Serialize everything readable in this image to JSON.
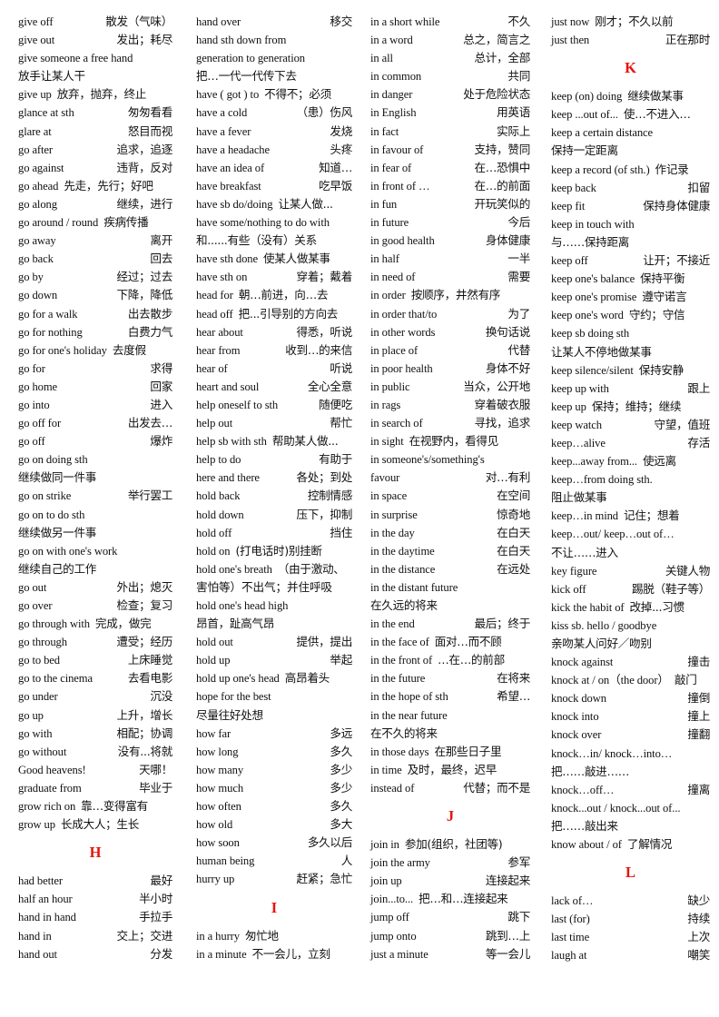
{
  "page": {
    "title": "English Phrase List G-L",
    "heading_color": "#e8140c",
    "text_color": "#111111",
    "background": "#ffffff"
  },
  "columns": [
    {
      "id": "column-1",
      "entries": [
        {
          "en": "give off",
          "cn": "散发（气味）"
        },
        {
          "en": "give out",
          "cn": "发出；耗尽"
        },
        {
          "en": "give someone a free hand",
          "cn": "放手让某人干",
          "layout": "wrap"
        },
        {
          "en": "give up",
          "cn": "放弃，抛弃，终止",
          "layout": "tight"
        },
        {
          "en": "glance at sth",
          "cn": "匆匆看看"
        },
        {
          "en": "glare at",
          "cn": "怒目而视"
        },
        {
          "en": "go after",
          "cn": "追求，追逐"
        },
        {
          "en": "go against",
          "cn": "违背，反对"
        },
        {
          "en": "go ahead",
          "cn": "先走，先行；好吧",
          "layout": "tight"
        },
        {
          "en": "go along",
          "cn": "继续，进行"
        },
        {
          "en": "go around / round",
          "cn": "疾病传播",
          "layout": "tight"
        },
        {
          "en": "go away",
          "cn": "离开"
        },
        {
          "en": "go back",
          "cn": "回去"
        },
        {
          "en": "go by",
          "cn": "经过；过去"
        },
        {
          "en": "go down",
          "cn": "下降，降低"
        },
        {
          "en": "go for a walk",
          "cn": "出去散步"
        },
        {
          "en": "go for nothing",
          "cn": "白费力气"
        },
        {
          "en": "go for one's holiday",
          "cn": "去度假",
          "layout": "tight"
        },
        {
          "en": "go for",
          "cn": "求得"
        },
        {
          "en": "go home",
          "cn": "回家"
        },
        {
          "en": "go into",
          "cn": "进入"
        },
        {
          "en": "go off for",
          "cn": "出发去…"
        },
        {
          "en": "go off",
          "cn": "爆炸"
        },
        {
          "en": "go on doing sth",
          "cn": "继续做同一件事",
          "layout": "wrap"
        },
        {
          "en": "go on strike",
          "cn": "举行罢工"
        },
        {
          "en": "go on to do sth",
          "cn": "继续做另一件事",
          "layout": "wrap"
        },
        {
          "en": "go on with one's work",
          "cn": "继续自己的工作",
          "layout": "wrap"
        },
        {
          "en": "go out",
          "cn": "外出；熄灭"
        },
        {
          "en": "go over",
          "cn": "检查；复习"
        },
        {
          "en": "go through with",
          "cn": "完成，做完",
          "layout": "tight"
        },
        {
          "en": "go through",
          "cn": "遭受；经历"
        },
        {
          "en": "go to bed",
          "cn": "上床睡觉"
        },
        {
          "en": "go to the cinema",
          "cn": "去看电影"
        },
        {
          "en": "go under",
          "cn": "沉没"
        },
        {
          "en": "go up",
          "cn": "上升，增长"
        },
        {
          "en": "go with",
          "cn": "相配；协调"
        },
        {
          "en": "go without",
          "cn": "没有...将就"
        },
        {
          "en": "Good heavens!",
          "cn": "天哪！"
        },
        {
          "en": "graduate from",
          "cn": "毕业于"
        },
        {
          "en": "grow rich on",
          "cn": "靠…变得富有",
          "layout": "tight"
        },
        {
          "en": "grow up",
          "cn": "长成大人；生长",
          "layout": "tight"
        },
        {
          "letter": "H"
        },
        {
          "en": "had better",
          "cn": "最好"
        },
        {
          "en": "half an hour",
          "cn": "半小时"
        },
        {
          "en": "hand in hand",
          "cn": "手拉手"
        },
        {
          "en": "hand in",
          "cn": "交上；交进"
        },
        {
          "en": "hand out",
          "cn": "分发"
        }
      ]
    },
    {
      "id": "column-2",
      "entries": [
        {
          "en": "hand over",
          "cn": "移交"
        },
        {
          "en": "hand sth down from",
          "cn": "",
          "layout": "wrap"
        },
        {
          "en": "generation to generation",
          "cn": "把…一代一代传下去",
          "layout": "wrap"
        },
        {
          "en": "have ( got ) to",
          "cn": "不得不；必须",
          "layout": "tight"
        },
        {
          "en": "have a cold",
          "cn": "（患）伤风"
        },
        {
          "en": "have a fever",
          "cn": "发烧"
        },
        {
          "en": "have a headache",
          "cn": "头疼"
        },
        {
          "en": "have an idea of",
          "cn": "知道…"
        },
        {
          "en": "have breakfast",
          "cn": "吃早饭"
        },
        {
          "en": "have sb do/doing",
          "cn": "让某人做...",
          "layout": "tight"
        },
        {
          "en": "have some/nothing to do with",
          "cn": "和......有些（没有）关系",
          "layout": "wrap"
        },
        {
          "en": "have sth done",
          "cn": "使某人做某事",
          "layout": "tight"
        },
        {
          "en": "have sth on",
          "cn": "穿着；戴着"
        },
        {
          "en": "head for",
          "cn": "朝…前进，向…去",
          "layout": "tight"
        },
        {
          "en": "head off",
          "cn": "把...引导别的方向去",
          "layout": "tight"
        },
        {
          "en": "hear about",
          "cn": "得悉，听说"
        },
        {
          "en": "hear from",
          "cn": "收到…的来信"
        },
        {
          "en": "hear of",
          "cn": "听说"
        },
        {
          "en": "heart and soul",
          "cn": "全心全意"
        },
        {
          "en": "help oneself to sth",
          "cn": "随便吃"
        },
        {
          "en": "help out",
          "cn": "帮忙"
        },
        {
          "en": "help sb with sth",
          "cn": "帮助某人做...",
          "layout": "tight"
        },
        {
          "en": "help to do",
          "cn": "有助于"
        },
        {
          "en": "here and there",
          "cn": "各处；到处"
        },
        {
          "en": "hold back",
          "cn": "控制情感"
        },
        {
          "en": "hold down",
          "cn": "压下，抑制"
        },
        {
          "en": "hold off",
          "cn": "挡住"
        },
        {
          "en": "hold on",
          "cn": "(打电话时)别挂断",
          "layout": "tight"
        },
        {
          "en": "hold one's breath",
          "cn": "（由于激动、",
          "layout": "tight"
        },
        {
          "en": "害怕等）不出气；并住呼吸",
          "cn": "",
          "layout": "wrap"
        },
        {
          "en": " hold one's head high",
          "cn": "昂首，趾高气昂",
          "layout": "wrap"
        },
        {
          "en": "hold out",
          "cn": "提供，提出"
        },
        {
          "en": "hold up",
          "cn": "举起"
        },
        {
          "en": "hold up one's head",
          "cn": "高昂着头",
          "layout": "tight"
        },
        {
          "en": "hope for the best",
          "cn": "尽量往好处想",
          "layout": "wrap"
        },
        {
          "en": "how far",
          "cn": "多远"
        },
        {
          "en": "how long",
          "cn": "多久"
        },
        {
          "en": "how many",
          "cn": "多少"
        },
        {
          "en": "how much",
          "cn": "多少"
        },
        {
          "en": "how often",
          "cn": "多久"
        },
        {
          "en": "how old",
          "cn": "多大"
        },
        {
          "en": "how soon",
          "cn": "多久以后"
        },
        {
          "en": "human being",
          "cn": "人"
        },
        {
          "en": "hurry up",
          "cn": "赶紧；急忙"
        },
        {
          "letter": "I"
        },
        {
          "en": "in a hurry",
          "cn": "匆忙地",
          "layout": "tight"
        },
        {
          "en": "in a minute",
          "cn": "不一会儿，立刻",
          "layout": "tight"
        }
      ]
    },
    {
      "id": "column-3",
      "entries": [
        {
          "en": "in a short while",
          "cn": "不久"
        },
        {
          "en": "in a word",
          "cn": "总之，简言之"
        },
        {
          "en": "in all",
          "cn": "总计，全部"
        },
        {
          "en": "in common",
          "cn": "共同"
        },
        {
          "en": "in danger",
          "cn": "处于危险状态"
        },
        {
          "en": "in English",
          "cn": "用英语"
        },
        {
          "en": "in fact",
          "cn": "实际上"
        },
        {
          "en": "in favour of",
          "cn": "支持，赞同"
        },
        {
          "en": "in fear of",
          "cn": "在…恐惧中"
        },
        {
          "en": "in front of …",
          "cn": "在…的前面"
        },
        {
          "en": "in fun",
          "cn": "开玩笑似的"
        },
        {
          "en": "in future",
          "cn": "今后"
        },
        {
          "en": "in good health",
          "cn": "身体健康"
        },
        {
          "en": "in half",
          "cn": "一半"
        },
        {
          "en": "in need of",
          "cn": "需要"
        },
        {
          "en": "in order",
          "cn": "按顺序，井然有序",
          "layout": "tight"
        },
        {
          "en": "in order that/to",
          "cn": "为了"
        },
        {
          "en": "in other words",
          "cn": "换句话说"
        },
        {
          "en": "in place of",
          "cn": "代替"
        },
        {
          "en": "in poor health",
          "cn": "身体不好"
        },
        {
          "en": "in public",
          "cn": "当众，公开地"
        },
        {
          "en": "in rags",
          "cn": "穿着破衣服"
        },
        {
          "en": "in search of",
          "cn": "寻找，追求"
        },
        {
          "en": "in sight",
          "cn": "在视野内，看得见",
          "layout": "tight"
        },
        {
          "en": "in someone's/something's",
          "cn": "",
          "layout": "wrap"
        },
        {
          "en": "favour",
          "cn": "对…有利"
        },
        {
          "en": "in space",
          "cn": "在空间"
        },
        {
          "en": "in surprise",
          "cn": "惊奇地"
        },
        {
          "en": "in the day",
          "cn": "在白天"
        },
        {
          "en": "in the daytime",
          "cn": "在白天"
        },
        {
          "en": "in the distance",
          "cn": "在远处"
        },
        {
          "en": "in the distant future",
          "cn": "在久远的将来",
          "layout": "wrap"
        },
        {
          "en": "in the end",
          "cn": "最后；终于"
        },
        {
          "en": "in the face of",
          "cn": "面对…而不顾",
          "layout": "tight"
        },
        {
          "en": "in the front of",
          "cn": "…在…的前部",
          "layout": "tight"
        },
        {
          "en": "in the future",
          "cn": "在将来"
        },
        {
          "en": "in the hope of sth",
          "cn": "希望…"
        },
        {
          "en": "in the near future",
          "cn": "在不久的将来",
          "layout": "wrap"
        },
        {
          "en": "in those days",
          "cn": "在那些日子里",
          "layout": "tight"
        },
        {
          "en": "in time",
          "cn": "及时，最终，迟早",
          "layout": "tight"
        },
        {
          "en": "instead of",
          "cn": "代替；而不是"
        },
        {
          "letter": "J"
        },
        {
          "en": "join in",
          "cn": "参加(组织，社团等)",
          "layout": "tight"
        },
        {
          "en": "join the army",
          "cn": "参军"
        },
        {
          "en": "join up",
          "cn": "连接起来"
        },
        {
          "en": "join...to...",
          "cn": "把…和…连接起来",
          "layout": "tight"
        },
        {
          "en": "jump off",
          "cn": "跳下"
        },
        {
          "en": "jump onto",
          "cn": "跳到…上"
        },
        {
          "en": "just a minute",
          "cn": "等一会儿"
        }
      ]
    },
    {
      "id": "column-4",
      "entries": [
        {
          "en": "just now",
          "cn": "刚才；不久以前",
          "layout": "tight"
        },
        {
          "en": "just then",
          "cn": "正在那时"
        },
        {
          "letter": "K"
        },
        {
          "en": "keep (on) doing",
          "cn": "继续做某事",
          "layout": "tight"
        },
        {
          "en": "keep ...out of...",
          "cn": "使…不进入…",
          "layout": "tight"
        },
        {
          "en": "keep a certain distance",
          "cn": "保持一定距离",
          "layout": "wrap"
        },
        {
          "en": "keep a record (of sth.)",
          "cn": "作记录",
          "layout": "tight"
        },
        {
          "en": "keep back",
          "cn": "扣留"
        },
        {
          "en": "keep fit",
          "cn": "保持身体健康"
        },
        {
          "en": "keep in touch with",
          "cn": "与……保持距离",
          "layout": "wrap"
        },
        {
          "en": "keep off",
          "cn": "让开；不接近"
        },
        {
          "en": "keep one's balance",
          "cn": "保持平衡",
          "layout": "tight"
        },
        {
          "en": "keep one's promise",
          "cn": "遵守诺言",
          "layout": "tight"
        },
        {
          "en": "keep one's word",
          "cn": "守约；守信",
          "layout": "tight"
        },
        {
          "en": "keep sb doing sth",
          "cn": "让某人不停地做某事",
          "layout": "wrap"
        },
        {
          "en": "keep silence/silent",
          "cn": "保持安静",
          "layout": "tight"
        },
        {
          "en": "keep up with",
          "cn": "跟上"
        },
        {
          "en": "keep up",
          "cn": "保持；维持；继续",
          "layout": "tight"
        },
        {
          "en": "keep watch",
          "cn": "守望，值班"
        },
        {
          "en": "keep…alive",
          "cn": "存活"
        },
        {
          "en": "keep...away from...",
          "cn": "使远离",
          "layout": "tight"
        },
        {
          "en": "keep…from doing sth.",
          "cn": "阻止做某事",
          "layout": "wrap"
        },
        {
          "en": "keep…in mind",
          "cn": "记住；想着",
          "layout": "tight"
        },
        {
          "en": "keep…out/ keep…out of…",
          "cn": "不让……进入",
          "layout": "wrap"
        },
        {
          "en": "key figure",
          "cn": "关键人物"
        },
        {
          "en": "kick off",
          "cn": "踢脱（鞋子等）"
        },
        {
          "en": "kick the habit of",
          "cn": "改掉...习惯",
          "layout": "tight"
        },
        {
          "en": "kiss sb. hello / goodbye",
          "cn": "亲吻某人问好／吻别",
          "layout": "wrap"
        },
        {
          "en": "knock against",
          "cn": "撞击"
        },
        {
          "en": "knock at / on（the door）",
          "cn": "敲门",
          "layout": "tight"
        },
        {
          "en": "knock down",
          "cn": "撞倒"
        },
        {
          "en": "knock into",
          "cn": "撞上"
        },
        {
          "en": "knock over",
          "cn": "撞翻"
        },
        {
          "en": "knock…in/ knock…into…",
          "cn": "把……敲进……",
          "layout": "wrap"
        },
        {
          "en": "knock…off…",
          "cn": "撞离"
        },
        {
          "en": "knock...out / knock...out of...",
          "cn": "把……敲出来",
          "layout": "wrap"
        },
        {
          "en": "know about / of",
          "cn": "了解情况",
          "layout": "tight"
        },
        {
          "letter": "L"
        },
        {
          "en": "lack of…",
          "cn": "缺少"
        },
        {
          "en": "last (for)",
          "cn": "持续"
        },
        {
          "en": "last time",
          "cn": "上次"
        },
        {
          "en": "laugh at",
          "cn": "嘲笑"
        }
      ]
    }
  ]
}
